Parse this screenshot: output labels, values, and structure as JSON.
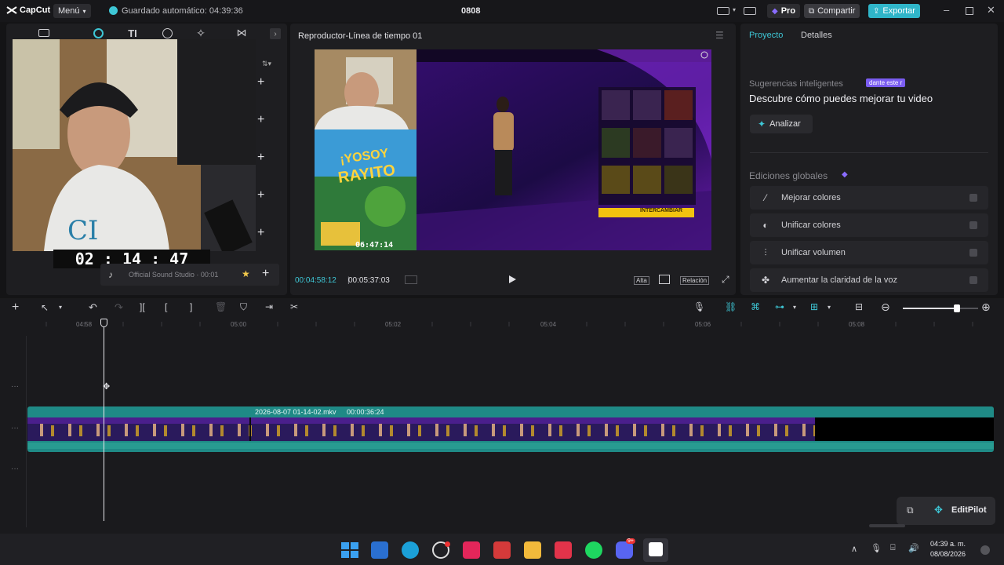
{
  "app": {
    "logo_text": "CapCut",
    "menu_label": "Menú",
    "autosave_text": "Guardado automático: 04:39:36",
    "project_name": "0808",
    "pro_label": "Pro",
    "share_label": "Compartir",
    "export_label": "Exportar"
  },
  "left_panel": {
    "overlay_timer": "02 : 14 : 47",
    "audio_item_label": "Official Sound Studio · 00:01"
  },
  "player": {
    "title": "Reproductor-Línea de tiempo 01",
    "current_time": "00:04:58:12",
    "total_time": "00:05:37:03",
    "quality_label": "Alta",
    "ratio_label": "Relación",
    "preview_timer": "06:47:14",
    "preview_title_line1": "¡YOSOY",
    "preview_title_line2": "RAYITO",
    "preview_exchange_button": "INTERCAMBIAR"
  },
  "right_panel": {
    "tabs": [
      "Proyecto",
      "Detalles"
    ],
    "smart_title": "Sugerencias inteligentes",
    "smart_badge": "dante este r",
    "smart_subtitle": "Descubre cómo puedes mejorar tu video",
    "analyze_label": "Analizar",
    "global_title": "Ediciones globales",
    "global_items": [
      {
        "label": "Mejorar colores",
        "icon": "magic-wand-icon"
      },
      {
        "label": "Unificar colores",
        "icon": "palette-icon"
      },
      {
        "label": "Unificar volumen",
        "icon": "sliders-icon"
      },
      {
        "label": "Aumentar la claridad de la voz",
        "icon": "voice-icon"
      }
    ]
  },
  "timeline": {
    "ticks": [
      "04:58",
      "05:00",
      "05:02",
      "05:04",
      "05:06",
      "05:08"
    ],
    "clip_label": "2026-08-07 01-14-02.mkv",
    "clip_duration": "00:00:36:24",
    "zoom_level": 0.72,
    "editpilot_label": "EditPilot"
  },
  "taskbar": {
    "time": "04:39 a. m.",
    "date": "08/08/2026",
    "discord_badge": "9+"
  },
  "colors": {
    "accent": "#3ec7d6",
    "export": "#2fb5c9",
    "clip_teal": "#1f8a86",
    "pro_purple": "#8a6cff"
  }
}
